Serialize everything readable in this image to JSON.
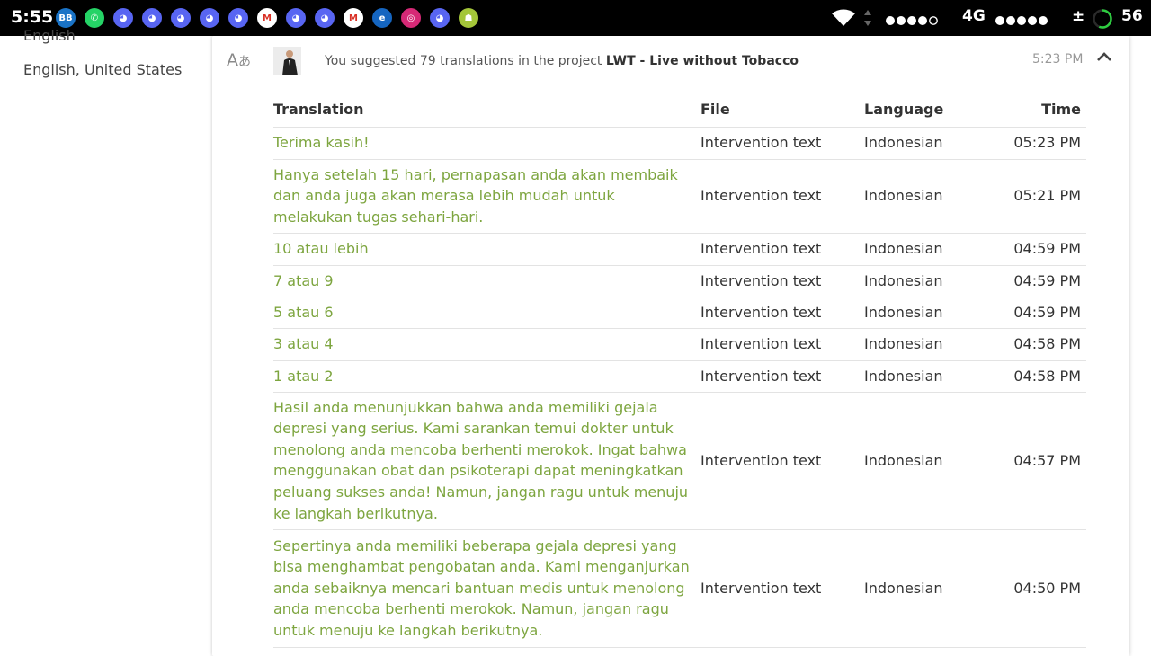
{
  "status_bar": {
    "time": "5:55",
    "apps": [
      {
        "icon": "blackberry-icon",
        "color": "#1a73c6",
        "glyph": "BB"
      },
      {
        "icon": "whatsapp-icon",
        "color": "#25d366",
        "glyph": "✆"
      },
      {
        "icon": "discord-icon",
        "color": "#5865f2",
        "glyph": "◕"
      },
      {
        "icon": "discord-icon",
        "color": "#5865f2",
        "glyph": "◕"
      },
      {
        "icon": "discord-icon",
        "color": "#5865f2",
        "glyph": "◕"
      },
      {
        "icon": "discord-icon",
        "color": "#5865f2",
        "glyph": "◕"
      },
      {
        "icon": "discord-icon",
        "color": "#5865f2",
        "glyph": "◕"
      },
      {
        "icon": "gmail-icon",
        "color": "#ffffff",
        "glyph": "M"
      },
      {
        "icon": "discord-icon",
        "color": "#5865f2",
        "glyph": "◕"
      },
      {
        "icon": "discord-icon",
        "color": "#5865f2",
        "glyph": "◕"
      },
      {
        "icon": "gmail-icon",
        "color": "#ffffff",
        "glyph": "M"
      },
      {
        "icon": "browser-icon",
        "color": "#1565c0",
        "glyph": "e"
      },
      {
        "icon": "instagram-icon",
        "color": "#d62976",
        "glyph": "◎"
      },
      {
        "icon": "discord-icon",
        "color": "#5865f2",
        "glyph": "◕"
      },
      {
        "icon": "android-icon",
        "color": "#a4c639",
        "glyph": "☗"
      }
    ],
    "network": "4G",
    "data_indicator": "±",
    "battery_level": "56",
    "battery_fraction": 0.56
  },
  "sidebar": {
    "items": [
      "English",
      "English, United States"
    ]
  },
  "activity": {
    "prefix": "You suggested 79 translations in the project ",
    "project": "LWT - Live without Tobacco",
    "time": "5:23 PM",
    "accent_color": "#7da53f"
  },
  "table": {
    "headers": {
      "translation": "Translation",
      "file": "File",
      "language": "Language",
      "time": "Time"
    },
    "rows": [
      {
        "translation": "Terima kasih!",
        "file": "Intervention text",
        "language": "Indonesian",
        "time": "05:23 PM"
      },
      {
        "translation": "Hanya setelah 15 hari, pernapasan anda akan membaik dan anda juga akan merasa lebih mudah untuk melakukan tugas sehari-hari.",
        "file": "Intervention text",
        "language": "Indonesian",
        "time": "05:21 PM"
      },
      {
        "translation": "10 atau lebih",
        "file": "Intervention text",
        "language": "Indonesian",
        "time": "04:59 PM"
      },
      {
        "translation": "7 atau 9",
        "file": "Intervention text",
        "language": "Indonesian",
        "time": "04:59 PM"
      },
      {
        "translation": "5 atau 6",
        "file": "Intervention text",
        "language": "Indonesian",
        "time": "04:59 PM"
      },
      {
        "translation": "3 atau 4",
        "file": "Intervention text",
        "language": "Indonesian",
        "time": "04:58 PM"
      },
      {
        "translation": "1 atau 2",
        "file": "Intervention text",
        "language": "Indonesian",
        "time": "04:58 PM"
      },
      {
        "translation": "Hasil anda menunjukkan bahwa anda memiliki gejala depresi yang serius. Kami sarankan temui dokter untuk menolong anda mencoba berhenti merokok. Ingat bahwa menggunakan obat dan psikoterapi dapat meningkatkan peluang sukses anda! Namun, jangan ragu untuk menuju ke langkah berikutnya.",
        "file": "Intervention text",
        "language": "Indonesian",
        "time": "04:57 PM"
      },
      {
        "translation": "Sepertinya anda memiliki beberapa gejala depresi yang bisa menghambat pengobatan anda. Kami menganjurkan anda sebaiknya mencari bantuan medis untuk menolong anda mencoba berhenti merokok. Namun, jangan ragu untuk menuju ke langkah berikutnya.",
        "file": "Intervention text",
        "language": "Indonesian",
        "time": "04:50 PM"
      }
    ]
  }
}
